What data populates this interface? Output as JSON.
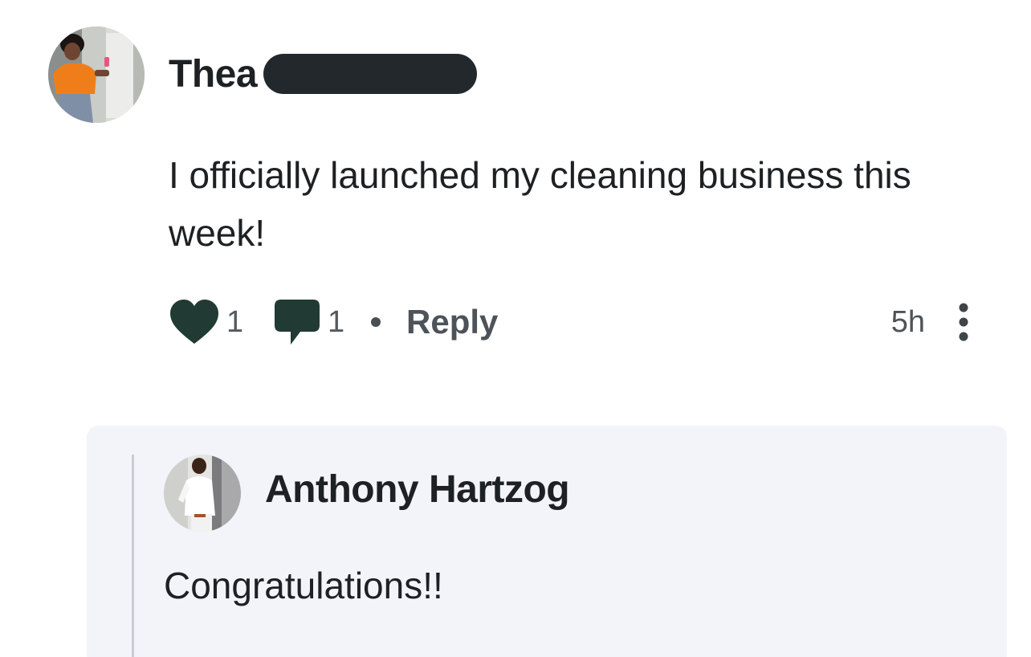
{
  "post": {
    "author_name": "Thea",
    "body": "I officially launched my cleaning business this week!",
    "likes_count": "1",
    "comments_count": "1",
    "reply_label": "Reply",
    "timestamp": "5h",
    "icons": {
      "like": "heart-icon",
      "comment": "speech-bubble-icon",
      "more": "vertical-ellipsis-icon"
    }
  },
  "reply": {
    "author_name": "Anthony Hartzog",
    "body": "Congratulations!!"
  },
  "colors": {
    "action_icon": "#213a33",
    "redaction": "#22282c",
    "reply_panel_bg": "#f3f4f9",
    "thread_line": "#c9ccd8"
  }
}
